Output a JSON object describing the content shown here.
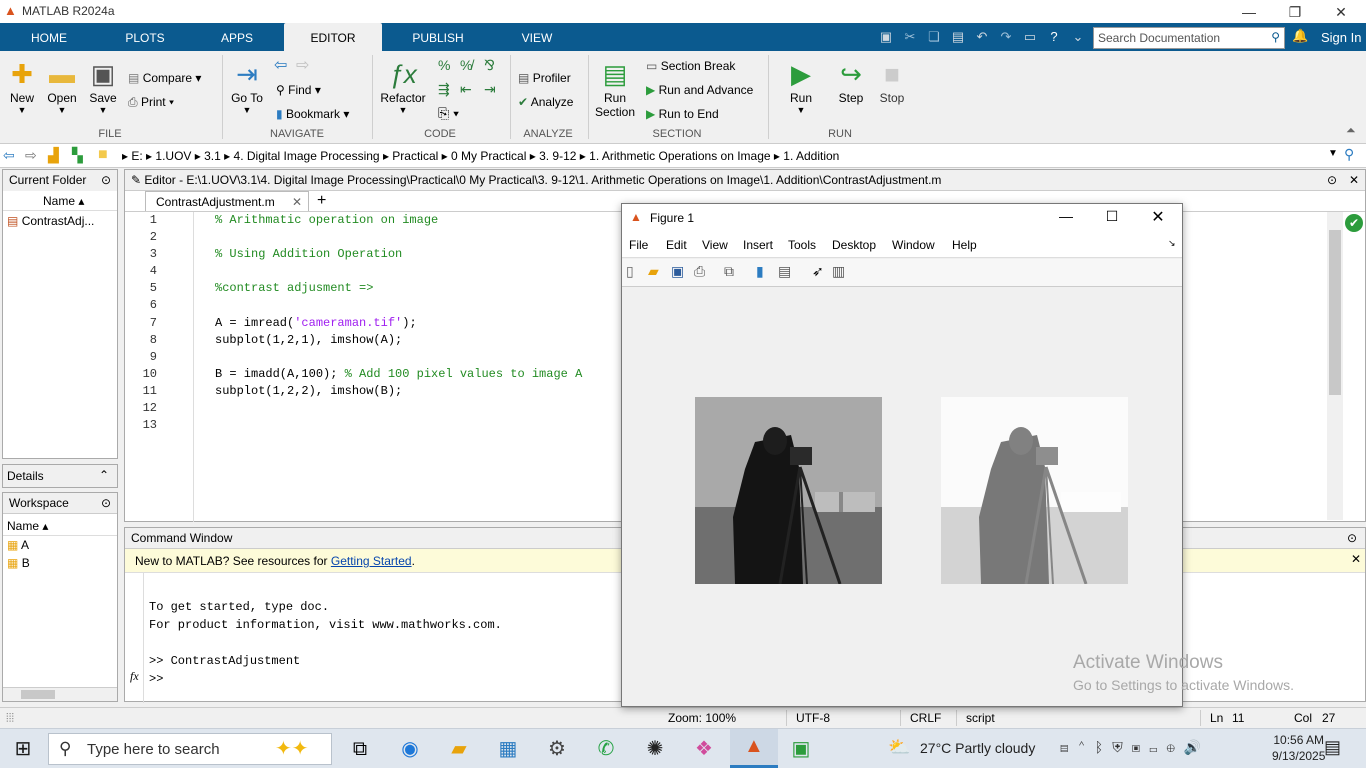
{
  "window": {
    "title": "MATLAB R2024a",
    "min": "—",
    "max": "❐",
    "close": "✕"
  },
  "tabs": [
    "HOME",
    "PLOTS",
    "APPS",
    "EDITOR",
    "PUBLISH",
    "VIEW"
  ],
  "search": {
    "placeholder": "Search Documentation"
  },
  "signin": "Sign In",
  "ribbon": {
    "file": {
      "label": "FILE",
      "new": "New",
      "open": "Open",
      "save": "Save",
      "compare": "Compare",
      "print": "Print"
    },
    "navigate": {
      "label": "NAVIGATE",
      "goto": "Go To",
      "find": "Find",
      "bookmark": "Bookmark"
    },
    "code": {
      "label": "CODE",
      "refactor": "Refactor"
    },
    "analyze": {
      "label": "ANALYZE",
      "profiler": "Profiler",
      "analyze": "Analyze"
    },
    "section": {
      "label": "SECTION",
      "run_section_1": "Run",
      "run_section_2": "Section",
      "section_break": "Section Break",
      "run_advance": "Run and Advance",
      "run_end": "Run to End"
    },
    "run": {
      "label": "RUN",
      "run": "Run",
      "step": "Step",
      "stop": "Stop"
    }
  },
  "path": [
    "E:",
    "1.UOV",
    "3.1",
    "4. Digital Image Processing",
    "Practical",
    "0 My Practical",
    "3. 9-12",
    "1. Arithmetic Operations on Image",
    "1. Addition"
  ],
  "current_folder": {
    "title": "Current Folder",
    "col": "Name",
    "files": [
      "ContrastAdj..."
    ]
  },
  "details": "Details",
  "workspace": {
    "title": "Workspace",
    "col": "Name",
    "vars": [
      "A",
      "B"
    ]
  },
  "editor": {
    "title": "Editor - E:\\1.UOV\\3.1\\4. Digital Image Processing\\Practical\\0 My Practical\\3. 9-12\\1. Arithmetic Operations on Image\\1. Addition\\ContrastAdjustment.m",
    "tab": "ContrastAdjustment.m",
    "lines": [
      {
        "n": "1",
        "code": "",
        "comment": "% Arithmatic operation on image"
      },
      {
        "n": "2",
        "code": "",
        "comment": ""
      },
      {
        "n": "3",
        "code": "",
        "comment": "% Using Addition Operation"
      },
      {
        "n": "4",
        "code": "",
        "comment": ""
      },
      {
        "n": "5",
        "code": "",
        "comment": "%contrast adjusment =>"
      },
      {
        "n": "6",
        "code": "",
        "comment": ""
      },
      {
        "n": "7",
        "code": "A = imread(",
        "str": "'cameraman.tif'",
        "tail": ");"
      },
      {
        "n": "8",
        "code": "subplot(1,2,1), imshow(A);"
      },
      {
        "n": "9",
        "code": ""
      },
      {
        "n": "10",
        "code": "B = imadd(A,100); ",
        "comment": "% Add 100 pixel values to image A"
      },
      {
        "n": "11",
        "code": "subplot(1,2,2), imshow(B);"
      },
      {
        "n": "12",
        "code": ""
      },
      {
        "n": "13",
        "code": ""
      }
    ]
  },
  "command": {
    "title": "Command Window",
    "banner_text": "New to MATLAB? See resources for ",
    "banner_link": "Getting Started",
    "banner_end": ".",
    "lines": [
      "To get started, type doc.",
      "For product information, visit www.mathworks.com.",
      "",
      ">> ContrastAdjustment"
    ],
    "prompt": ">>"
  },
  "figure": {
    "title": "Figure 1",
    "menu": [
      "File",
      "Edit",
      "View",
      "Insert",
      "Tools",
      "Desktop",
      "Window",
      "Help"
    ]
  },
  "status": {
    "zoom": "Zoom: 100%",
    "enc": "UTF-8",
    "eol": "CRLF",
    "type": "script",
    "ln_label": "Ln",
    "ln": "11",
    "col_label": "Col",
    "col": "27"
  },
  "watermark": {
    "line1": "Activate Windows",
    "line2": "Go to Settings to activate Windows."
  },
  "taskbar": {
    "search": "Type here to search",
    "weather": "27°C  Partly cloudy",
    "time": "10:56 AM",
    "date": "9/13/2025"
  }
}
